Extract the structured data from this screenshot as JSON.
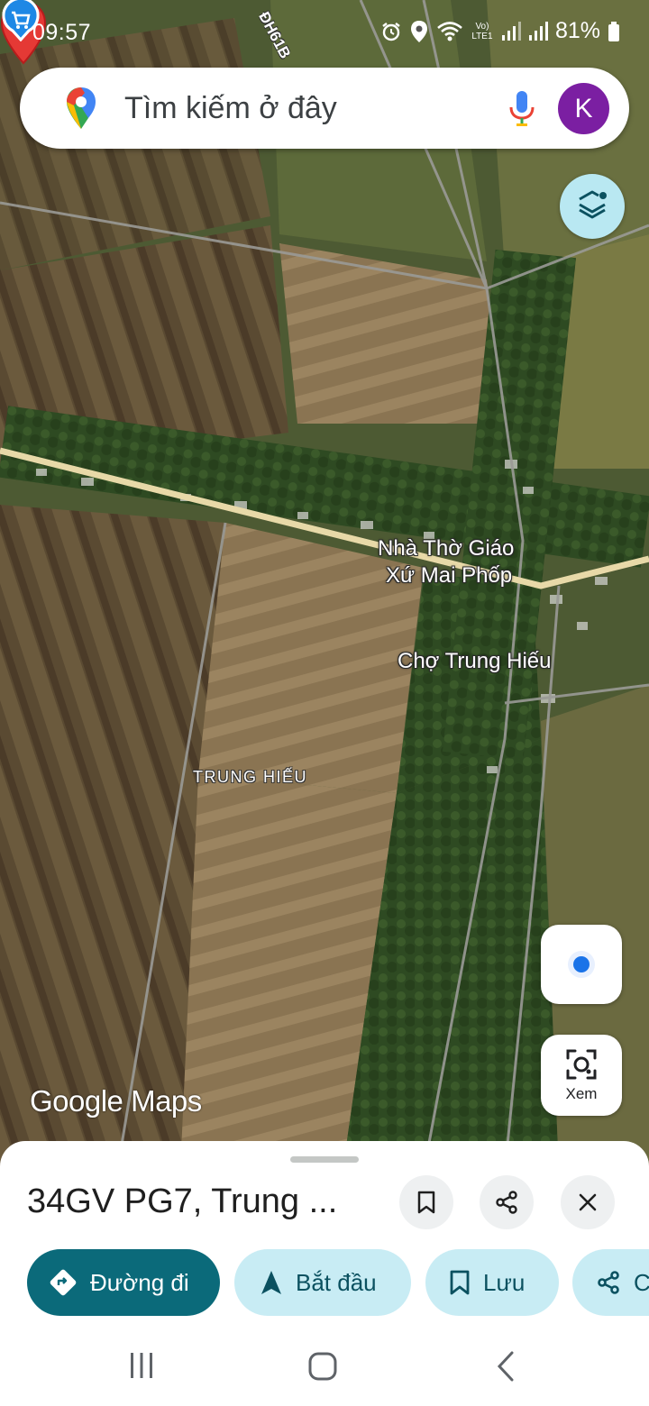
{
  "status_bar": {
    "time": "09:57",
    "network": "Vo) LTE1",
    "battery": "81%"
  },
  "search": {
    "placeholder": "Tìm kiếm ở đây",
    "avatar_letter": "K"
  },
  "map": {
    "road_label": "ĐH61B",
    "labels": {
      "church_line1": "Nhà Thờ Giáo",
      "church_line2": "Xứ Mai Phốp",
      "market": "Chợ Trung Hiếu",
      "area": "TRUNG HIẾU"
    },
    "watermark": "Google Maps",
    "lens_label": "Xem"
  },
  "place": {
    "title": "34GV PG7, Trung ..."
  },
  "chips": {
    "directions": "Đường đi",
    "start": "Bắt đầu",
    "save": "Lưu",
    "share": "C"
  },
  "colors": {
    "primary_chip": "#0b6a7a",
    "secondary_chip": "#c8ecf4",
    "avatar": "#7b1fa2",
    "pin": "#e53935",
    "location_dot": "#1a73e8"
  },
  "icons": [
    "maps-logo-icon",
    "mic-icon",
    "layers-icon",
    "church-icon",
    "cart-icon",
    "location-icon",
    "lens-icon",
    "bookmark-icon",
    "share-icon",
    "close-icon",
    "directions-icon",
    "navigation-icon",
    "recents-icon",
    "home-icon",
    "back-icon"
  ]
}
